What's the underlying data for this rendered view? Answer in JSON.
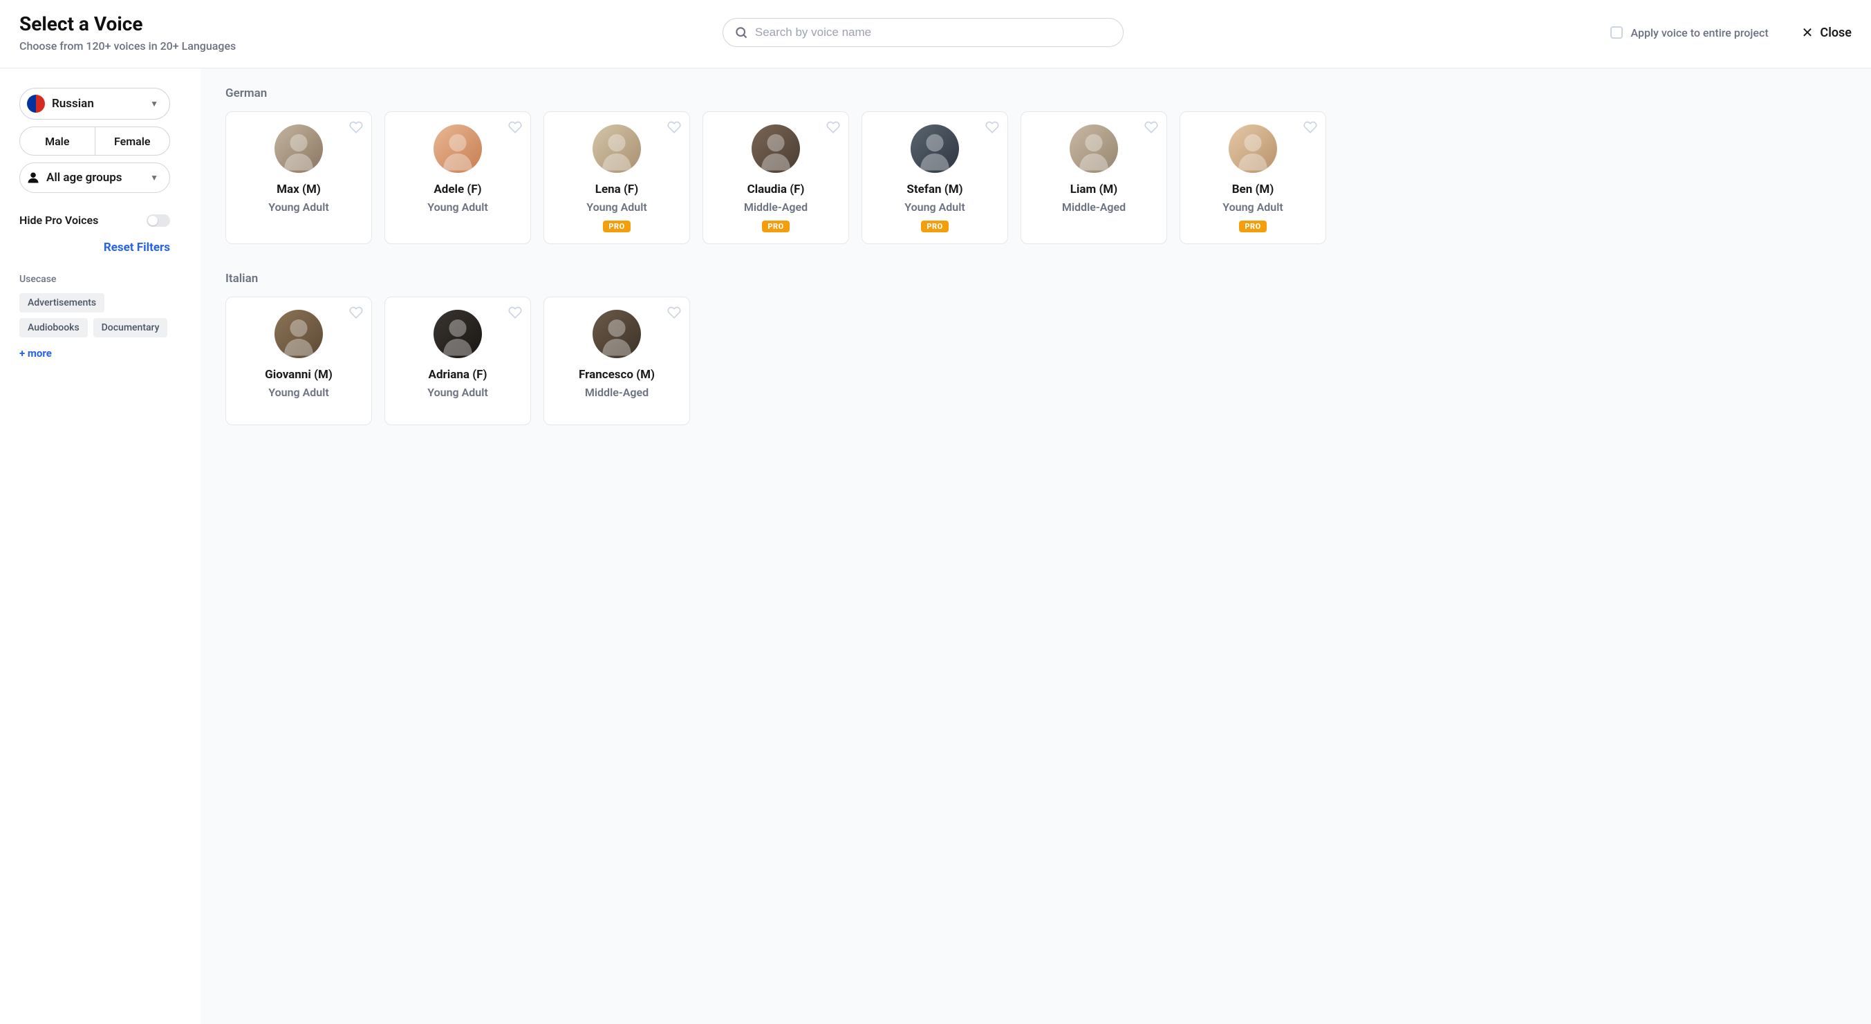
{
  "header": {
    "title": "Select a Voice",
    "subtitle": "Choose from 120+ voices in 20+ Languages",
    "search_placeholder": "Search by voice name",
    "apply_label": "Apply voice to entire project",
    "close_label": "Close"
  },
  "sidebar": {
    "language": "Russian",
    "gender_male": "Male",
    "gender_female": "Female",
    "age_filter": "All age groups",
    "hide_pro_label": "Hide Pro Voices",
    "reset_label": "Reset Filters",
    "usecase_header": "Usecase",
    "usecase_tags": [
      "Advertisements",
      "Audiobooks",
      "Documentary"
    ],
    "more_label": "+ more"
  },
  "sections": [
    {
      "title": "German",
      "voices": [
        {
          "name": "Max (M)",
          "age": "Young Adult",
          "pro": false,
          "av": "av1"
        },
        {
          "name": "Adele (F)",
          "age": "Young Adult",
          "pro": false,
          "av": "av2"
        },
        {
          "name": "Lena (F)",
          "age": "Young Adult",
          "pro": true,
          "av": "av3"
        },
        {
          "name": "Claudia (F)",
          "age": "Middle-Aged",
          "pro": true,
          "av": "av4"
        },
        {
          "name": "Stefan (M)",
          "age": "Young Adult",
          "pro": true,
          "av": "av5"
        },
        {
          "name": "Liam (M)",
          "age": "Middle-Aged",
          "pro": false,
          "av": "av6"
        },
        {
          "name": "Ben (M)",
          "age": "Young Adult",
          "pro": true,
          "av": "av7"
        }
      ]
    },
    {
      "title": "Italian",
      "voices": [
        {
          "name": "Giovanni (M)",
          "age": "Young Adult",
          "pro": false,
          "av": "av8"
        },
        {
          "name": "Adriana (F)",
          "age": "Young Adult",
          "pro": false,
          "av": "av9"
        },
        {
          "name": "Francesco (M)",
          "age": "Middle-Aged",
          "pro": false,
          "av": "av10"
        }
      ]
    }
  ],
  "labels": {
    "pro": "PRO"
  }
}
